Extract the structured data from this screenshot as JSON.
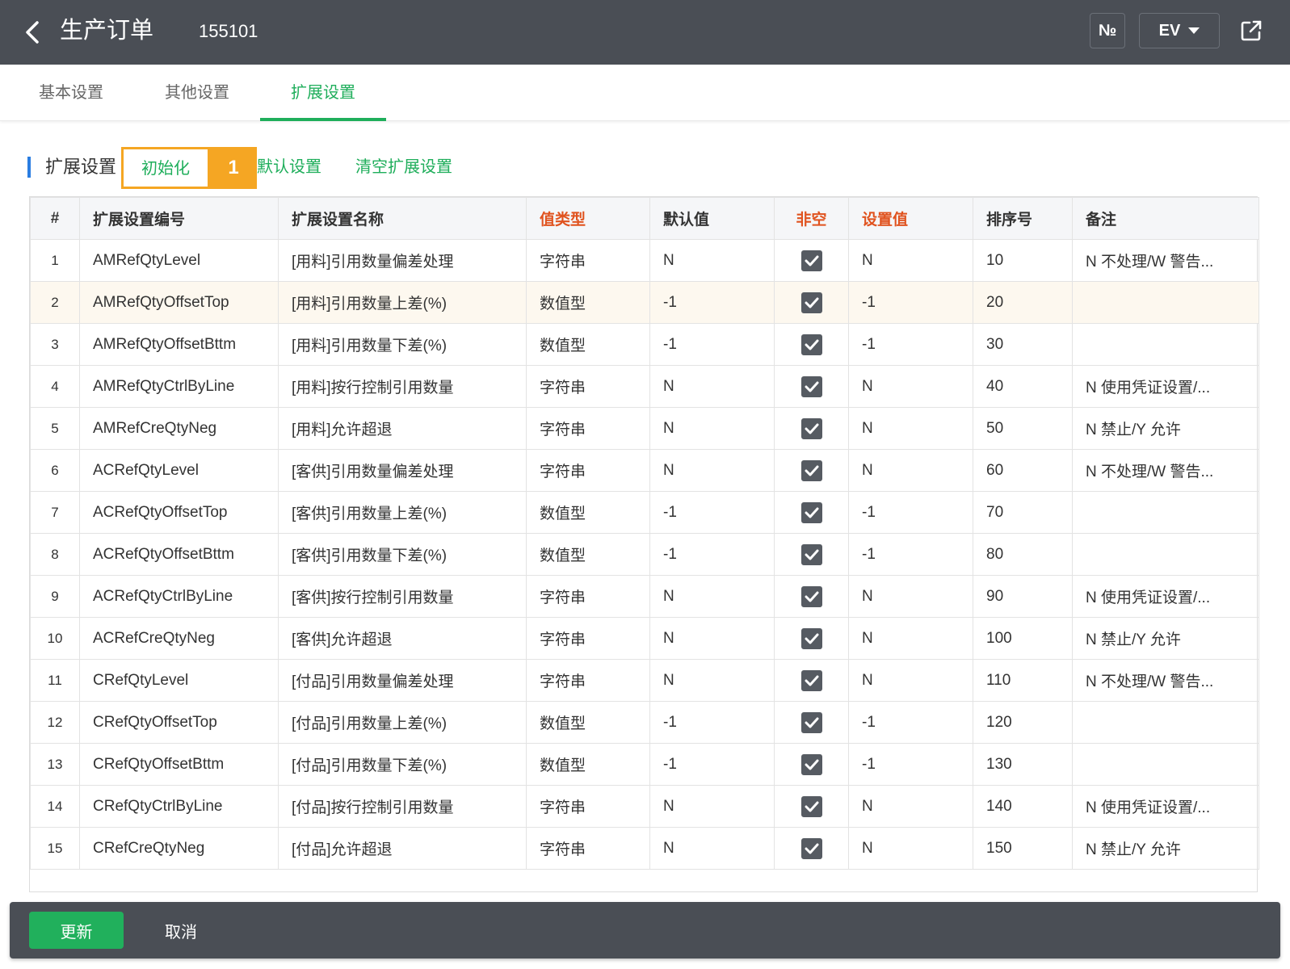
{
  "header": {
    "title": "生产订单",
    "order_no": "155101",
    "no_button": "№",
    "ev_button": "EV"
  },
  "tabs": [
    {
      "label": "基本设置"
    },
    {
      "label": "其他设置"
    },
    {
      "label": "扩展设置",
      "active": true
    }
  ],
  "toolbar": {
    "section_title": "扩展设置",
    "init_label": "初始化",
    "step_badge": "1",
    "default_label": "默认设置",
    "clear_label": "清空扩展设置"
  },
  "table": {
    "columns": [
      {
        "label": "#",
        "required": false
      },
      {
        "label": "扩展设置编号",
        "required": false
      },
      {
        "label": "扩展设置名称",
        "required": false
      },
      {
        "label": "值类型",
        "required": true
      },
      {
        "label": "默认值",
        "required": false
      },
      {
        "label": "非空",
        "required": true
      },
      {
        "label": "设置值",
        "required": true
      },
      {
        "label": "排序号",
        "required": false
      },
      {
        "label": "备注",
        "required": false
      }
    ],
    "rows": [
      {
        "no": "1",
        "code": "AMRefQtyLevel",
        "name": "[用料]引用数量偏差处理",
        "type": "字符串",
        "default": "N",
        "not_null": true,
        "value": "N",
        "sort": "10",
        "remark": "N 不处理/W 警告..."
      },
      {
        "no": "2",
        "code": "AMRefQtyOffsetTop",
        "name": "[用料]引用数量上差(%)",
        "type": "数值型",
        "default": "-1",
        "not_null": true,
        "value": "-1",
        "sort": "20",
        "remark": ""
      },
      {
        "no": "3",
        "code": "AMRefQtyOffsetBttm",
        "name": "[用料]引用数量下差(%)",
        "type": "数值型",
        "default": "-1",
        "not_null": true,
        "value": "-1",
        "sort": "30",
        "remark": ""
      },
      {
        "no": "4",
        "code": "AMRefQtyCtrlByLine",
        "name": "[用料]按行控制引用数量",
        "type": "字符串",
        "default": "N",
        "not_null": true,
        "value": "N",
        "sort": "40",
        "remark": "N 使用凭证设置/..."
      },
      {
        "no": "5",
        "code": "AMRefCreQtyNeg",
        "name": "[用料]允许超退",
        "type": "字符串",
        "default": "N",
        "not_null": true,
        "value": "N",
        "sort": "50",
        "remark": "N 禁止/Y 允许"
      },
      {
        "no": "6",
        "code": "ACRefQtyLevel",
        "name": "[客供]引用数量偏差处理",
        "type": "字符串",
        "default": "N",
        "not_null": true,
        "value": "N",
        "sort": "60",
        "remark": "N 不处理/W 警告..."
      },
      {
        "no": "7",
        "code": "ACRefQtyOffsetTop",
        "name": "[客供]引用数量上差(%)",
        "type": "数值型",
        "default": "-1",
        "not_null": true,
        "value": "-1",
        "sort": "70",
        "remark": ""
      },
      {
        "no": "8",
        "code": "ACRefQtyOffsetBttm",
        "name": "[客供]引用数量下差(%)",
        "type": "数值型",
        "default": "-1",
        "not_null": true,
        "value": "-1",
        "sort": "80",
        "remark": ""
      },
      {
        "no": "9",
        "code": "ACRefQtyCtrlByLine",
        "name": "[客供]按行控制引用数量",
        "type": "字符串",
        "default": "N",
        "not_null": true,
        "value": "N",
        "sort": "90",
        "remark": "N 使用凭证设置/..."
      },
      {
        "no": "10",
        "code": "ACRefCreQtyNeg",
        "name": "[客供]允许超退",
        "type": "字符串",
        "default": "N",
        "not_null": true,
        "value": "N",
        "sort": "100",
        "remark": "N 禁止/Y 允许"
      },
      {
        "no": "11",
        "code": "CRefQtyLevel",
        "name": "[付品]引用数量偏差处理",
        "type": "字符串",
        "default": "N",
        "not_null": true,
        "value": "N",
        "sort": "110",
        "remark": "N 不处理/W 警告..."
      },
      {
        "no": "12",
        "code": "CRefQtyOffsetTop",
        "name": "[付品]引用数量上差(%)",
        "type": "数值型",
        "default": "-1",
        "not_null": true,
        "value": "-1",
        "sort": "120",
        "remark": ""
      },
      {
        "no": "13",
        "code": "CRefQtyOffsetBttm",
        "name": "[付品]引用数量下差(%)",
        "type": "数值型",
        "default": "-1",
        "not_null": true,
        "value": "-1",
        "sort": "130",
        "remark": ""
      },
      {
        "no": "14",
        "code": "CRefQtyCtrlByLine",
        "name": "[付品]按行控制引用数量",
        "type": "字符串",
        "default": "N",
        "not_null": true,
        "value": "N",
        "sort": "140",
        "remark": "N 使用凭证设置/..."
      },
      {
        "no": "15",
        "code": "CRefCreQtyNeg",
        "name": "[付品]允许超退",
        "type": "字符串",
        "default": "N",
        "not_null": true,
        "value": "N",
        "sort": "150",
        "remark": "N 禁止/Y 允许"
      }
    ]
  },
  "footer": {
    "update_label": "更新",
    "cancel_label": "取消"
  },
  "colors": {
    "header_bg": "#4a4e55",
    "accent_green": "#1fae5b",
    "required_red": "#e0531f",
    "highlight_orange": "#f5a623"
  }
}
